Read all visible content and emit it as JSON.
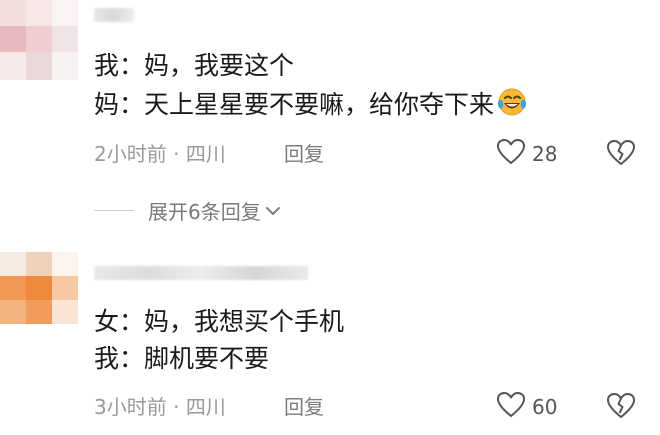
{
  "comments": [
    {
      "lines": [
        "我：妈，我要这个",
        "妈：天上星星要不要嘛，给你夺下来"
      ],
      "emoji": "laughing-crying-face-icon",
      "time": "2小时前",
      "separator": "·",
      "location": "四川",
      "reply_label": "回复",
      "likes": "28",
      "expand_replies_label": "展开6条回复"
    },
    {
      "lines": [
        "女：妈，我想买个手机",
        "我：脚机要不要"
      ],
      "time": "3小时前",
      "separator": "·",
      "location": "四川",
      "reply_label": "回复",
      "likes": "60"
    }
  ],
  "colors": {
    "text": "#1a1a1a",
    "meta": "#9a9a9a",
    "emoji_face": "#f9b938",
    "emoji_tears": "#3aa3f0"
  }
}
